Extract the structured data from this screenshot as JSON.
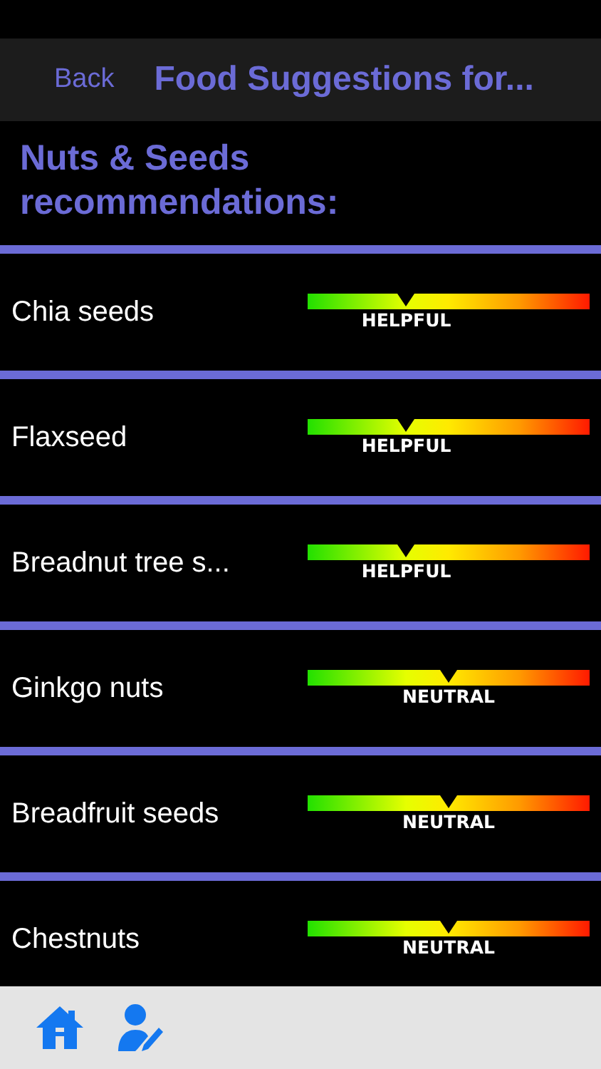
{
  "nav": {
    "back": "Back",
    "title": "Food Suggestions for..."
  },
  "heading": "Nuts & Seeds recommendations:",
  "items": [
    {
      "name": "Chia seeds",
      "rating": "HELPFUL",
      "level": 0.35
    },
    {
      "name": "Flaxseed",
      "rating": "HELPFUL",
      "level": 0.35
    },
    {
      "name": "Breadnut tree s...",
      "rating": "HELPFUL",
      "level": 0.35
    },
    {
      "name": "Ginkgo nuts",
      "rating": "NEUTRAL",
      "level": 0.5
    },
    {
      "name": "Breadfruit seeds",
      "rating": "NEUTRAL",
      "level": 0.5
    },
    {
      "name": "Chestnuts",
      "rating": "NEUTRAL",
      "level": 0.5
    }
  ]
}
